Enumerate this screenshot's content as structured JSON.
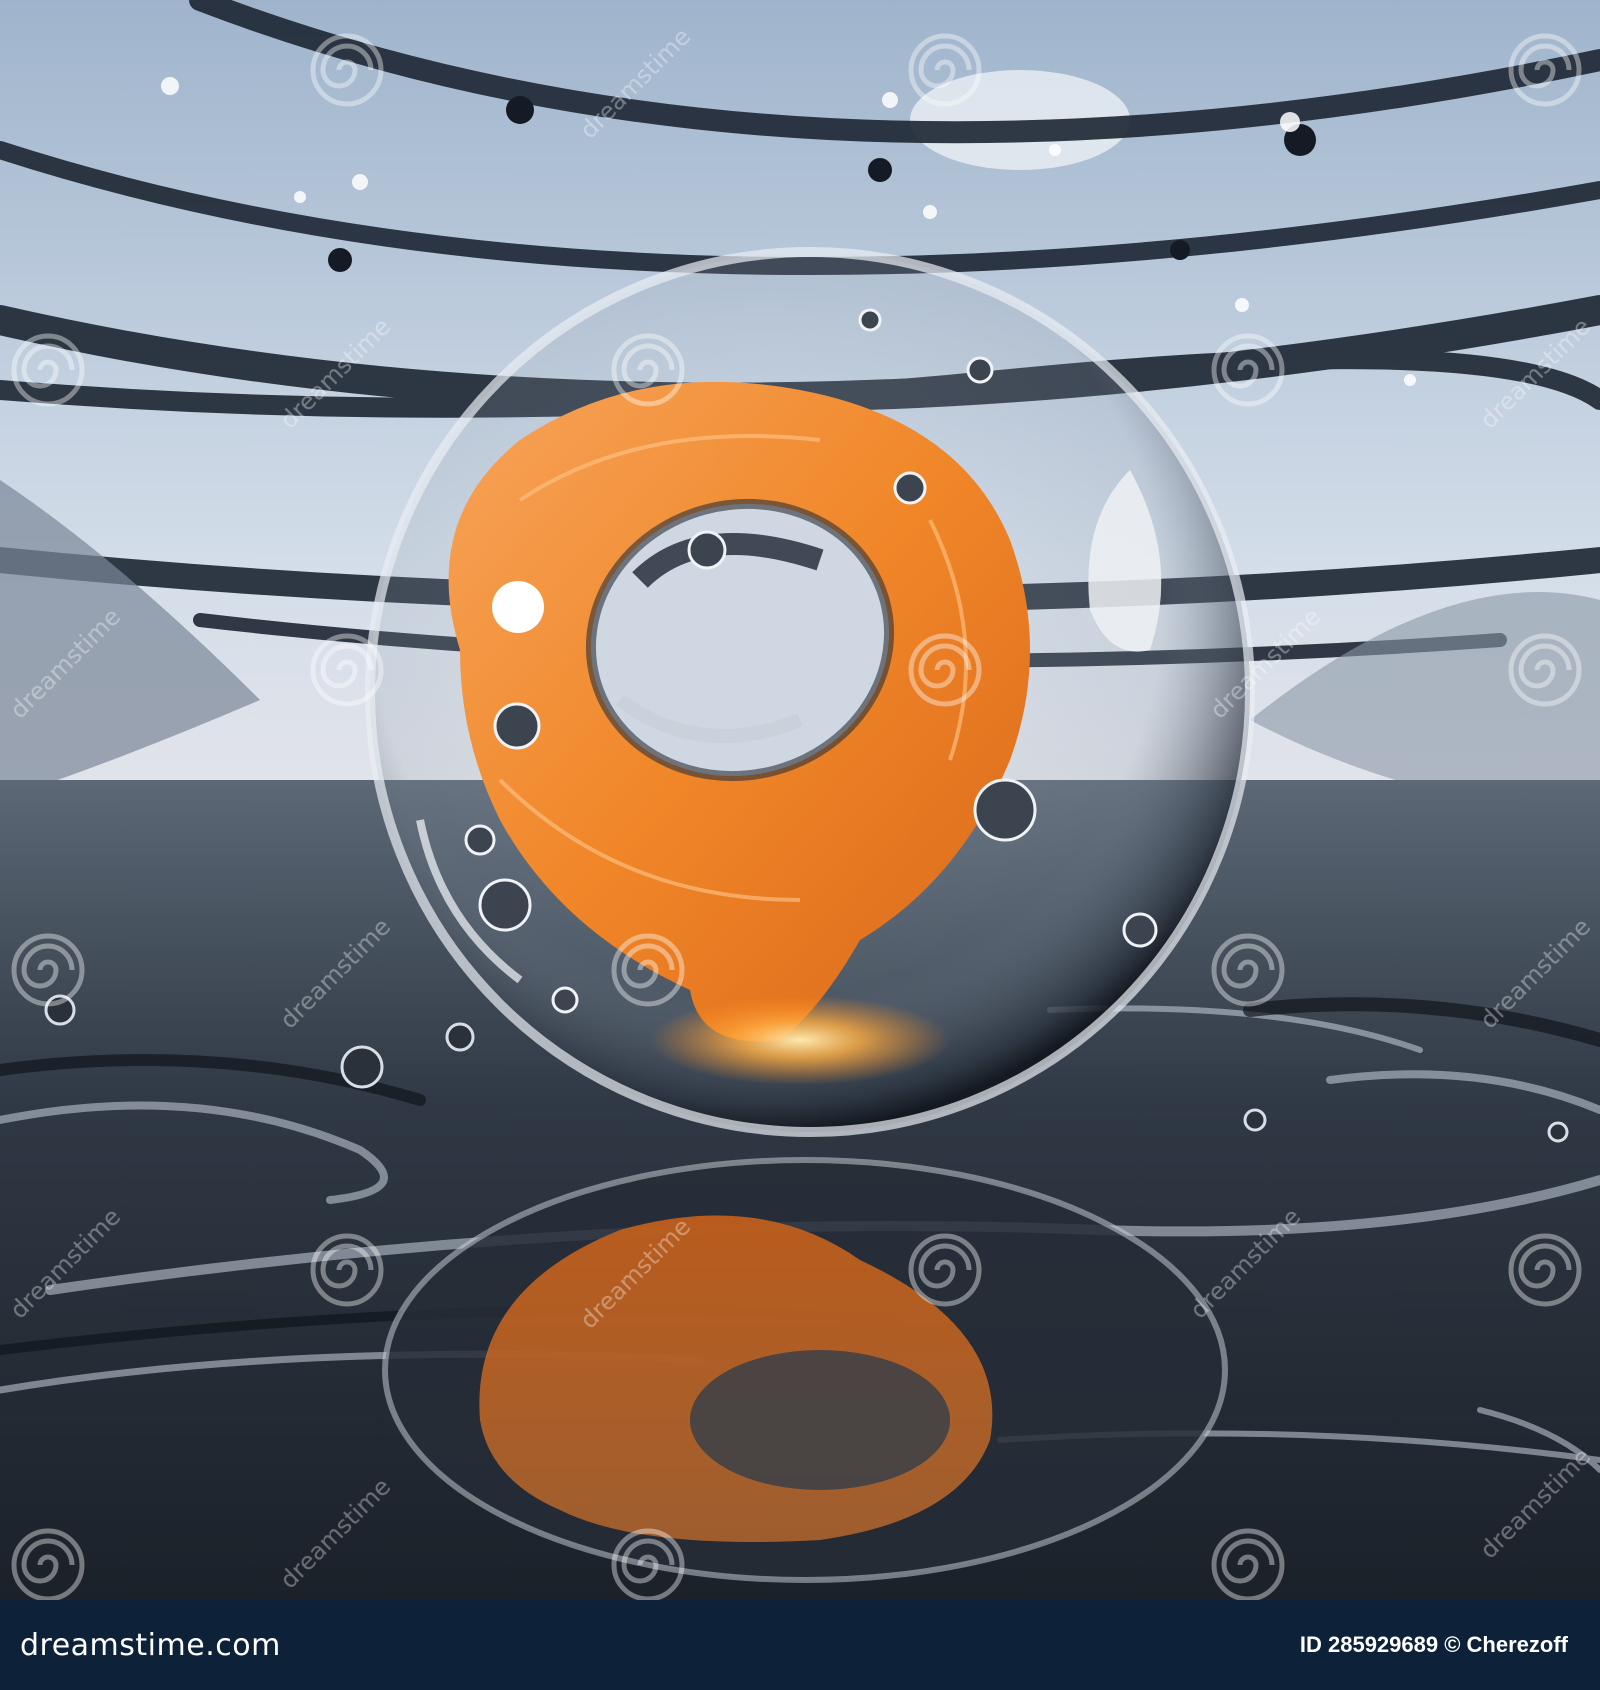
{
  "footer": {
    "site": "dreamstime.com",
    "credit": "ID 285929689 © Cherezoff"
  },
  "watermark": {
    "text": "dreamstime",
    "icon": "spiral-icon"
  },
  "colors": {
    "sky": "#c9d5e4",
    "orbit_bands": "#1d2633",
    "orange_swirl": "#f28a2a",
    "water": "#3b4552",
    "footer_bg": "#0d2138"
  }
}
